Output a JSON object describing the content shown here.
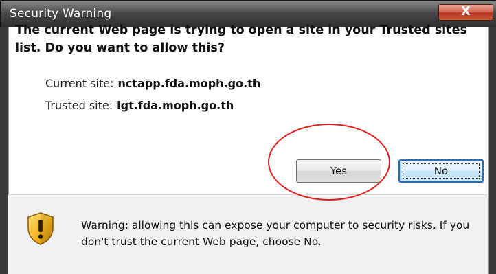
{
  "window": {
    "title": "Security Warning",
    "close_glyph": "X"
  },
  "message": {
    "heading": "The current Web page is trying to open a site in your Trusted sites list. Do you want to allow this?"
  },
  "sites": {
    "current_label": "Current site:",
    "current_value": "nctapp.fda.moph.go.th",
    "trusted_label": "Trusted site:",
    "trusted_value": "lgt.fda.moph.go.th"
  },
  "buttons": {
    "yes_label": "Yes",
    "no_label": "No"
  },
  "warning": {
    "icon": "shield-warning-icon",
    "text": "Warning: allowing this can expose your computer to security risks. If you don't trust the current Web page, choose No."
  },
  "colors": {
    "annotation_circle": "#e02020",
    "shield_yellow": "#f2b31f",
    "close_red": "#c44a30"
  }
}
